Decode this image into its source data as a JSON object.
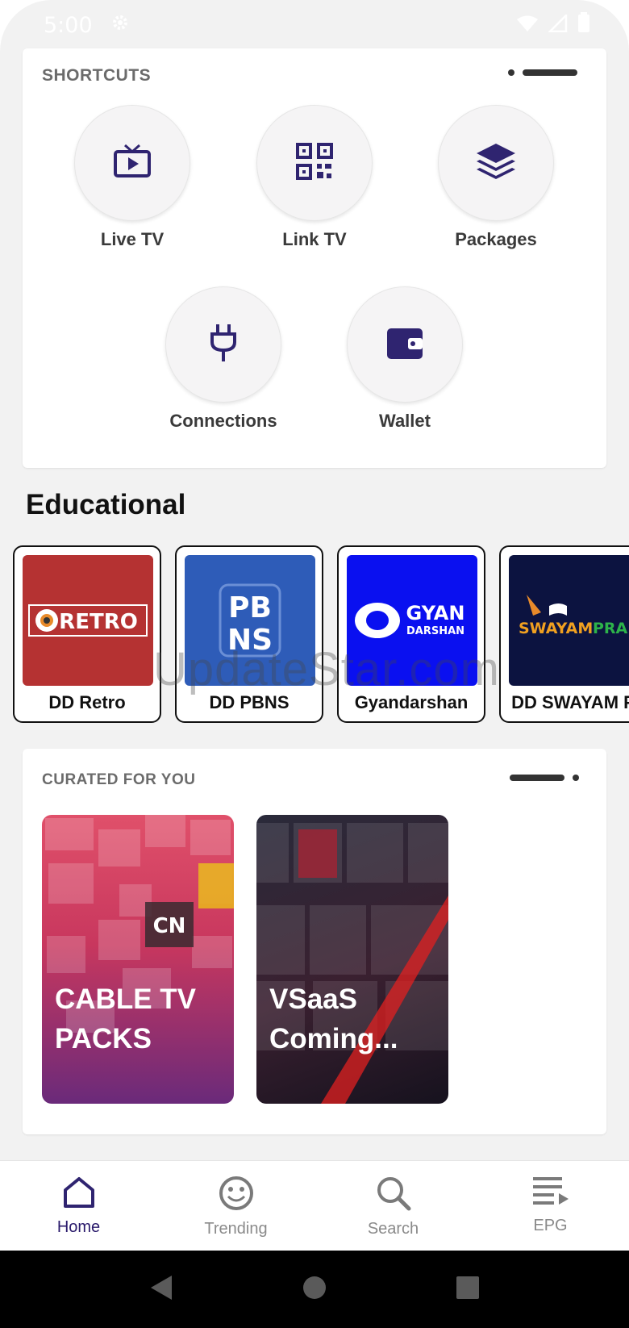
{
  "status_bar": {
    "time": "5:00"
  },
  "colors": {
    "accent": "#3a2a8c",
    "icon": "#2f2470",
    "inactive": "#8a8a8a"
  },
  "shortcuts": {
    "title": "SHORTCUTS",
    "items": [
      {
        "label": "Live TV",
        "icon": "tv-play-icon"
      },
      {
        "label": "Link TV",
        "icon": "qr-code-icon"
      },
      {
        "label": "Packages",
        "icon": "layers-icon"
      },
      {
        "label": "Connections",
        "icon": "plug-icon"
      },
      {
        "label": "Wallet",
        "icon": "wallet-icon"
      }
    ]
  },
  "educational": {
    "title": "Educational",
    "channels": [
      {
        "name": "DD Retro",
        "logo_text": "RETRO",
        "color": "#b53232"
      },
      {
        "name": "DD PBNS",
        "logo_text": "PB NS",
        "color": "#2e5cb8"
      },
      {
        "name": "Gyandarshan",
        "logo_text": "GYAN DARSHAN",
        "color": "#0a10f0"
      },
      {
        "name": "DD SWAYAM P",
        "logo_text": "SWAYAM PRABHA",
        "color": "#0c1340"
      }
    ]
  },
  "watermark": "UpdateStar.com",
  "curated": {
    "title": "CURATED FOR YOU",
    "items": [
      {
        "title": "CABLE TV PACKS"
      },
      {
        "title": "VSaaS Coming..."
      }
    ]
  },
  "bottom_nav": {
    "items": [
      {
        "label": "Home",
        "icon": "home-icon",
        "active": true
      },
      {
        "label": "Trending",
        "icon": "smiley-icon",
        "active": false
      },
      {
        "label": "Search",
        "icon": "search-icon",
        "active": false
      },
      {
        "label": "EPG",
        "icon": "epg-list-icon",
        "active": false
      }
    ]
  }
}
